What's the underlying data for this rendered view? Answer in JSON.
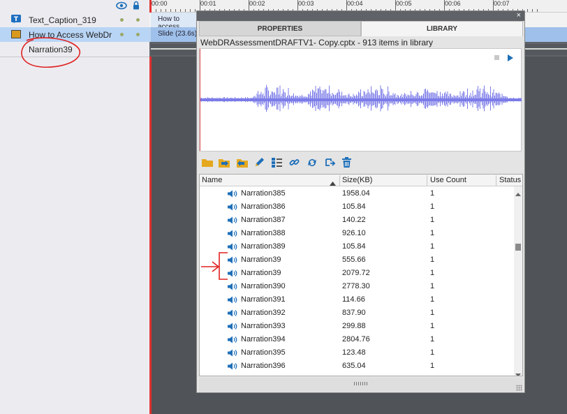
{
  "layers": [
    {
      "name": "Text_Caption_319",
      "icon": "text-caption-icon",
      "selected": false
    },
    {
      "name": "How to Access WebDr",
      "icon": "slide-icon",
      "selected": true
    },
    {
      "name": "Narration39",
      "icon": "",
      "selected": false
    }
  ],
  "timeline": {
    "ticks": [
      "00:00",
      "00:01",
      "00:02",
      "00:03",
      "00:04",
      "00:05",
      "00:06",
      "00:07"
    ],
    "clips": {
      "caption": "How to access",
      "slide": "Slide (23.6s)"
    }
  },
  "library": {
    "close_label": "×",
    "tabs": [
      {
        "label": "PROPERTIES",
        "active": false
      },
      {
        "label": "LIBRARY",
        "active": true
      }
    ],
    "info": "WebDRAssessmentDRAFTV1- Copy.cptx - 913 items in library",
    "toolbar_icons": [
      "open-folder-icon",
      "import-icon",
      "export-icon",
      "edit-icon",
      "properties-icon",
      "usage-link-icon",
      "update-icon",
      "duplicate-icon",
      "delete-icon"
    ],
    "columns": [
      "Name",
      "Size(KB)",
      "Use Count",
      "Status"
    ],
    "rows": [
      {
        "name": "Narration385",
        "size": "1958.04",
        "count": "1"
      },
      {
        "name": "Narration386",
        "size": "105.84",
        "count": "1"
      },
      {
        "name": "Narration387",
        "size": "140.22",
        "count": "1"
      },
      {
        "name": "Narration388",
        "size": "926.10",
        "count": "1"
      },
      {
        "name": "Narration389",
        "size": "105.84",
        "count": "1"
      },
      {
        "name": "Narration39",
        "size": "555.66",
        "count": "1"
      },
      {
        "name": "Narration39",
        "size": "2079.72",
        "count": "1"
      },
      {
        "name": "Narration390",
        "size": "2778.30",
        "count": "1"
      },
      {
        "name": "Narration391",
        "size": "114.66",
        "count": "1"
      },
      {
        "name": "Narration392",
        "size": "837.90",
        "count": "1"
      },
      {
        "name": "Narration393",
        "size": "299.88",
        "count": "1"
      },
      {
        "name": "Narration394",
        "size": "2804.76",
        "count": "1"
      },
      {
        "name": "Narration395",
        "size": "123.48",
        "count": "1"
      },
      {
        "name": "Narration396",
        "size": "635.04",
        "count": "1"
      }
    ]
  },
  "colors": {
    "selection": "#b9d5f5",
    "waveform": "#7b7be8",
    "annotation": "#e02020",
    "playhead": "#e03030"
  }
}
